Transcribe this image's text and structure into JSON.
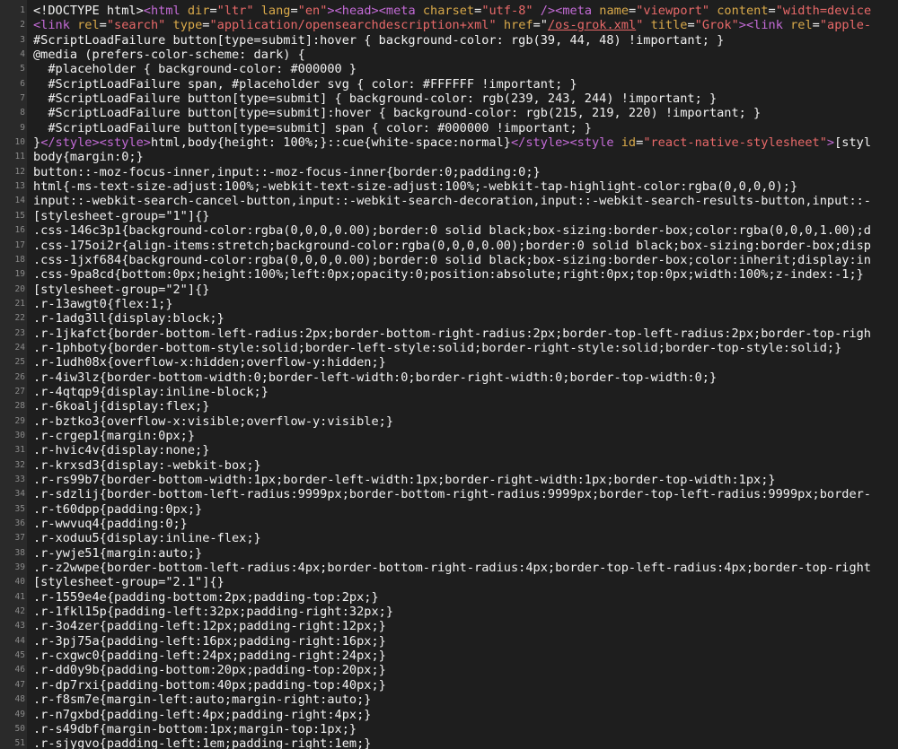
{
  "editor": {
    "language": "html",
    "colors": {
      "background": "#1e1e1e",
      "gutter": "#2a2a2a",
      "line_number": "#8a8a8a",
      "text": "#f2f2f2",
      "tag": "#c36bd6",
      "attribute": "#d9a94a",
      "string": "#e86969"
    },
    "lines": [
      {
        "n": "1",
        "segs": [
          [
            "plain",
            "<!DOCTYPE html>"
          ],
          [
            "tag",
            "<html "
          ],
          [
            "attr",
            "dir"
          ],
          [
            "plain",
            "="
          ],
          [
            "str",
            "\"ltr\""
          ],
          [
            "plain",
            " "
          ],
          [
            "attr",
            "lang"
          ],
          [
            "plain",
            "="
          ],
          [
            "str",
            "\"en\""
          ],
          [
            "tag",
            "><head><meta "
          ],
          [
            "attr",
            "charset"
          ],
          [
            "plain",
            "="
          ],
          [
            "str",
            "\"utf-8\""
          ],
          [
            "tag",
            " /><meta "
          ],
          [
            "attr",
            "name"
          ],
          [
            "plain",
            "="
          ],
          [
            "str",
            "\"viewport\""
          ],
          [
            "plain",
            " "
          ],
          [
            "attr",
            "content"
          ],
          [
            "plain",
            "="
          ],
          [
            "str",
            "\"width=device"
          ]
        ]
      },
      {
        "n": "2",
        "segs": [
          [
            "tag",
            "<link "
          ],
          [
            "attr",
            "rel"
          ],
          [
            "plain",
            "="
          ],
          [
            "str",
            "\"search\""
          ],
          [
            "plain",
            " "
          ],
          [
            "attr",
            "type"
          ],
          [
            "plain",
            "="
          ],
          [
            "str",
            "\"application/opensearchdescription+xml\""
          ],
          [
            "plain",
            " "
          ],
          [
            "attr",
            "href"
          ],
          [
            "plain",
            "=\""
          ],
          [
            "link",
            "/os-grok.xml"
          ],
          [
            "str",
            "\""
          ],
          [
            "plain",
            " "
          ],
          [
            "attr",
            "title"
          ],
          [
            "plain",
            "="
          ],
          [
            "str",
            "\"Grok\""
          ],
          [
            "tag",
            "><link "
          ],
          [
            "attr",
            "rel"
          ],
          [
            "plain",
            "="
          ],
          [
            "str",
            "\"apple-"
          ]
        ]
      },
      {
        "n": "3",
        "segs": [
          [
            "plain",
            "#ScriptLoadFailure button[type=submit]:hover { background-color: rgb(39, 44, 48) !important; }"
          ]
        ]
      },
      {
        "n": "4",
        "segs": [
          [
            "plain",
            "@media (prefers-color-scheme: dark) {"
          ]
        ]
      },
      {
        "n": "5",
        "segs": [
          [
            "plain",
            "  #placeholder { background-color: #000000 }"
          ]
        ]
      },
      {
        "n": "6",
        "segs": [
          [
            "plain",
            "  #ScriptLoadFailure span, #placeholder svg { color: #FFFFFF !important; }"
          ]
        ]
      },
      {
        "n": "7",
        "segs": [
          [
            "plain",
            "  #ScriptLoadFailure button[type=submit] { background-color: rgb(239, 243, 244) !important; }"
          ]
        ]
      },
      {
        "n": "8",
        "segs": [
          [
            "plain",
            "  #ScriptLoadFailure button[type=submit]:hover { background-color: rgb(215, 219, 220) !important; }"
          ]
        ]
      },
      {
        "n": "9",
        "segs": [
          [
            "plain",
            "  #ScriptLoadFailure button[type=submit] span { color: #000000 !important; }"
          ]
        ]
      },
      {
        "n": "10",
        "segs": [
          [
            "plain",
            "}"
          ],
          [
            "tag",
            "</style><style>"
          ],
          [
            "plain",
            "html,body{height: 100%;}::cue{white-space:normal}"
          ],
          [
            "tag",
            "</style><style "
          ],
          [
            "attr",
            "id"
          ],
          [
            "plain",
            "="
          ],
          [
            "str",
            "\"react-native-stylesheet\""
          ],
          [
            "tag",
            ">"
          ],
          [
            "plain",
            "[styl"
          ]
        ]
      },
      {
        "n": "11",
        "segs": [
          [
            "plain",
            "body{margin:0;}"
          ]
        ]
      },
      {
        "n": "12",
        "segs": [
          [
            "plain",
            "button::-moz-focus-inner,input::-moz-focus-inner{border:0;padding:0;}"
          ]
        ]
      },
      {
        "n": "13",
        "segs": [
          [
            "plain",
            "html{-ms-text-size-adjust:100%;-webkit-text-size-adjust:100%;-webkit-tap-highlight-color:rgba(0,0,0,0);}"
          ]
        ]
      },
      {
        "n": "14",
        "segs": [
          [
            "plain",
            "input::-webkit-search-cancel-button,input::-webkit-search-decoration,input::-webkit-search-results-button,input::-"
          ]
        ]
      },
      {
        "n": "15",
        "segs": [
          [
            "plain",
            "[stylesheet-group=\"1\"]{}"
          ]
        ]
      },
      {
        "n": "16",
        "segs": [
          [
            "plain",
            ".css-146c3p1{background-color:rgba(0,0,0,0.00);border:0 solid black;box-sizing:border-box;color:rgba(0,0,0,1.00);d"
          ]
        ]
      },
      {
        "n": "17",
        "segs": [
          [
            "plain",
            ".css-175oi2r{align-items:stretch;background-color:rgba(0,0,0,0.00);border:0 solid black;box-sizing:border-box;disp"
          ]
        ]
      },
      {
        "n": "18",
        "segs": [
          [
            "plain",
            ".css-1jxf684{background-color:rgba(0,0,0,0.00);border:0 solid black;box-sizing:border-box;color:inherit;display:in"
          ]
        ]
      },
      {
        "n": "19",
        "segs": [
          [
            "plain",
            ".css-9pa8cd{bottom:0px;height:100%;left:0px;opacity:0;position:absolute;right:0px;top:0px;width:100%;z-index:-1;}"
          ]
        ]
      },
      {
        "n": "20",
        "segs": [
          [
            "plain",
            "[stylesheet-group=\"2\"]{}"
          ]
        ]
      },
      {
        "n": "21",
        "segs": [
          [
            "plain",
            ".r-13awgt0{flex:1;}"
          ]
        ]
      },
      {
        "n": "22",
        "segs": [
          [
            "plain",
            ".r-1adg3ll{display:block;}"
          ]
        ]
      },
      {
        "n": "23",
        "segs": [
          [
            "plain",
            ".r-1jkafct{border-bottom-left-radius:2px;border-bottom-right-radius:2px;border-top-left-radius:2px;border-top-righ"
          ]
        ]
      },
      {
        "n": "24",
        "segs": [
          [
            "plain",
            ".r-1phboty{border-bottom-style:solid;border-left-style:solid;border-right-style:solid;border-top-style:solid;}"
          ]
        ]
      },
      {
        "n": "25",
        "segs": [
          [
            "plain",
            ".r-1udh08x{overflow-x:hidden;overflow-y:hidden;}"
          ]
        ]
      },
      {
        "n": "26",
        "segs": [
          [
            "plain",
            ".r-4iw3lz{border-bottom-width:0;border-left-width:0;border-right-width:0;border-top-width:0;}"
          ]
        ]
      },
      {
        "n": "27",
        "segs": [
          [
            "plain",
            ".r-4qtqp9{display:inline-block;}"
          ]
        ]
      },
      {
        "n": "28",
        "segs": [
          [
            "plain",
            ".r-6koalj{display:flex;}"
          ]
        ]
      },
      {
        "n": "29",
        "segs": [
          [
            "plain",
            ".r-bztko3{overflow-x:visible;overflow-y:visible;}"
          ]
        ]
      },
      {
        "n": "30",
        "segs": [
          [
            "plain",
            ".r-crgep1{margin:0px;}"
          ]
        ]
      },
      {
        "n": "31",
        "segs": [
          [
            "plain",
            ".r-hvic4v{display:none;}"
          ]
        ]
      },
      {
        "n": "32",
        "segs": [
          [
            "plain",
            ".r-krxsd3{display:-webkit-box;}"
          ]
        ]
      },
      {
        "n": "33",
        "segs": [
          [
            "plain",
            ".r-rs99b7{border-bottom-width:1px;border-left-width:1px;border-right-width:1px;border-top-width:1px;}"
          ]
        ]
      },
      {
        "n": "34",
        "segs": [
          [
            "plain",
            ".r-sdzlij{border-bottom-left-radius:9999px;border-bottom-right-radius:9999px;border-top-left-radius:9999px;border-"
          ]
        ]
      },
      {
        "n": "35",
        "segs": [
          [
            "plain",
            ".r-t60dpp{padding:0px;}"
          ]
        ]
      },
      {
        "n": "36",
        "segs": [
          [
            "plain",
            ".r-wwvuq4{padding:0;}"
          ]
        ]
      },
      {
        "n": "37",
        "segs": [
          [
            "plain",
            ".r-xoduu5{display:inline-flex;}"
          ]
        ]
      },
      {
        "n": "38",
        "segs": [
          [
            "plain",
            ".r-ywje51{margin:auto;}"
          ]
        ]
      },
      {
        "n": "39",
        "segs": [
          [
            "plain",
            ".r-z2wwpe{border-bottom-left-radius:4px;border-bottom-right-radius:4px;border-top-left-radius:4px;border-top-right"
          ]
        ]
      },
      {
        "n": "40",
        "segs": [
          [
            "plain",
            "[stylesheet-group=\"2.1\"]{}"
          ]
        ]
      },
      {
        "n": "41",
        "segs": [
          [
            "plain",
            ".r-1559e4e{padding-bottom:2px;padding-top:2px;}"
          ]
        ]
      },
      {
        "n": "42",
        "segs": [
          [
            "plain",
            ".r-1fkl15p{padding-left:32px;padding-right:32px;}"
          ]
        ]
      },
      {
        "n": "43",
        "segs": [
          [
            "plain",
            ".r-3o4zer{padding-left:12px;padding-right:12px;}"
          ]
        ]
      },
      {
        "n": "44",
        "segs": [
          [
            "plain",
            ".r-3pj75a{padding-left:16px;padding-right:16px;}"
          ]
        ]
      },
      {
        "n": "45",
        "segs": [
          [
            "plain",
            ".r-cxgwc0{padding-left:24px;padding-right:24px;}"
          ]
        ]
      },
      {
        "n": "46",
        "segs": [
          [
            "plain",
            ".r-dd0y9b{padding-bottom:20px;padding-top:20px;}"
          ]
        ]
      },
      {
        "n": "47",
        "segs": [
          [
            "plain",
            ".r-dp7rxi{padding-bottom:40px;padding-top:40px;}"
          ]
        ]
      },
      {
        "n": "48",
        "segs": [
          [
            "plain",
            ".r-f8sm7e{margin-left:auto;margin-right:auto;}"
          ]
        ]
      },
      {
        "n": "49",
        "segs": [
          [
            "plain",
            ".r-n7gxbd{padding-left:4px;padding-right:4px;}"
          ]
        ]
      },
      {
        "n": "50",
        "segs": [
          [
            "plain",
            ".r-s49dbf{margin-bottom:1px;margin-top:1px;}"
          ]
        ]
      },
      {
        "n": "51",
        "segs": [
          [
            "plain",
            ".r-sjygvo{padding-left:1em;padding-right:1em;}"
          ]
        ]
      }
    ]
  }
}
